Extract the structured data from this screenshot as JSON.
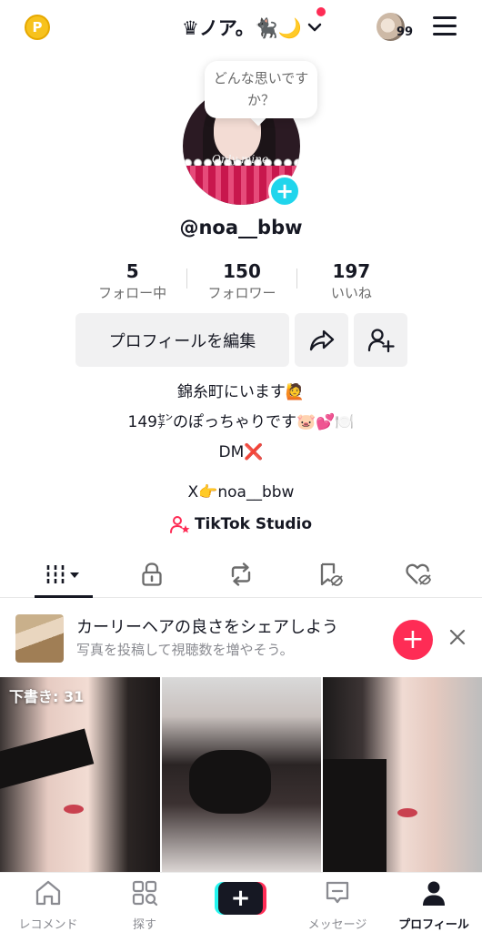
{
  "topbar": {
    "coin_icon": "coin-icon",
    "coin_label": "P",
    "account_name": "♛ノア。🐈‍⬛🌙",
    "avatar_badge": "99"
  },
  "profile": {
    "bubble_text": "どんな思いですか？",
    "photo_script": "Only mine",
    "add_label": "+",
    "username": "@noa__bbw",
    "stats": [
      {
        "value": "5",
        "label": "フォロー中"
      },
      {
        "value": "150",
        "label": "フォロワー"
      },
      {
        "value": "197",
        "label": "いいね"
      }
    ],
    "edit_button": "プロフィールを編集",
    "bio": [
      "錦糸町にいます🙋",
      "149㌢のぽっちゃりです🐷💕🍽️",
      "DM❌"
    ],
    "link": "X👉noa__bbw",
    "studio": "TikTok Studio"
  },
  "tabs": [
    "videos",
    "private",
    "reposts",
    "saved",
    "liked"
  ],
  "promo": {
    "title": "カーリーヘアの良さをシェアしよう",
    "subtitle": "写真を投稿して視聴数を増やそう。",
    "add_label": "+"
  },
  "grid": {
    "draft_label": "下書き: 31"
  },
  "bottom_nav": {
    "home": "レコメンド",
    "discover": "探す",
    "create": "+",
    "inbox": "メッセージ",
    "profile": "プロフィール"
  },
  "colors": {
    "accent": "#fe2c55",
    "cyan": "#20d5ec",
    "text": "#161823",
    "muted": "#8a8b91"
  }
}
